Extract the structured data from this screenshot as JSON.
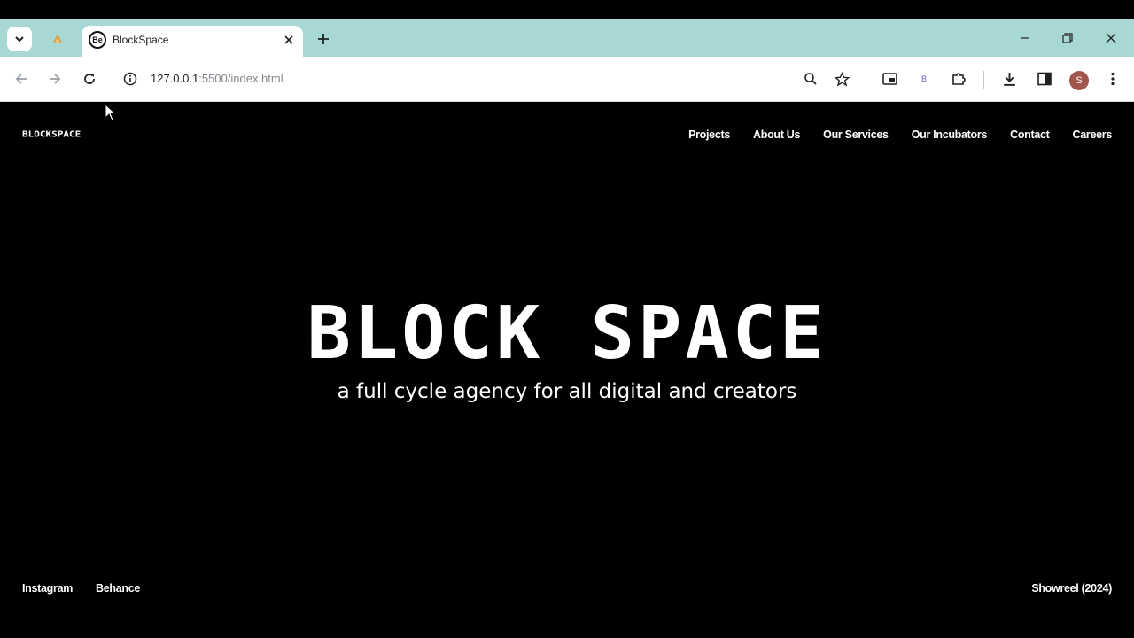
{
  "browser": {
    "tab": {
      "title": "BlockSpace",
      "favicon_text": "Be"
    },
    "address": {
      "host": "127.0.0.1",
      "port_path": ":5500/index.html"
    },
    "profile_initial": "S",
    "extension_badge": "B"
  },
  "site": {
    "logo": "BLOCKSPACE",
    "nav": [
      "Projects",
      "About Us",
      "Our Services",
      "Our Incubators",
      "Contact",
      "Careers"
    ],
    "hero": {
      "title": "BLOCK SPACE",
      "subtitle": "a full cycle agency for all digital and creators"
    },
    "social": [
      "Instagram",
      "Behance"
    ],
    "showreel": "Showreel (2024)"
  },
  "colors": {
    "tabbar": "#a8d8d4",
    "page_bg": "#000000",
    "text": "#ffffff"
  }
}
